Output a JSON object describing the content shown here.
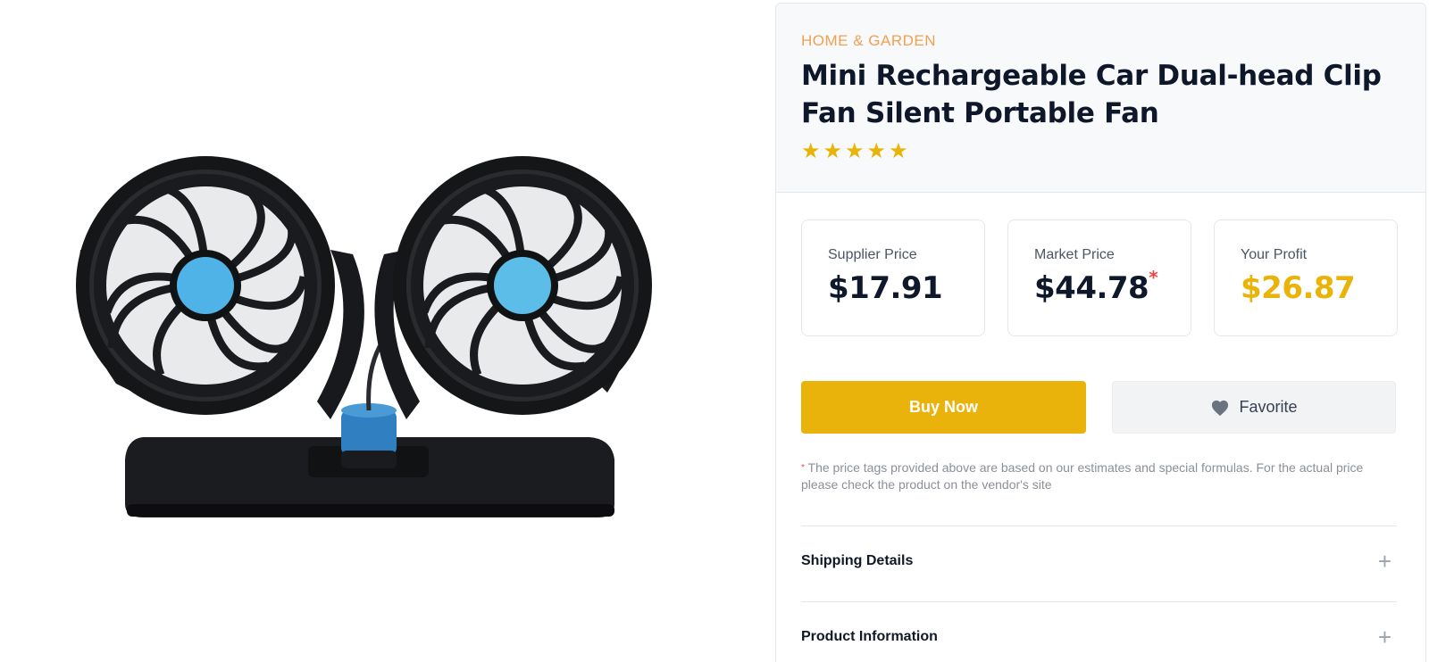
{
  "product": {
    "category": "HOME & GARDEN",
    "title": "Mini Rechargeable Car Dual-head Clip Fan Silent Portable Fan",
    "rating": 5,
    "stars": [
      "★",
      "★",
      "★",
      "★",
      "★"
    ]
  },
  "prices": {
    "supplier_label": "Supplier Price",
    "supplier_value": "$17.91",
    "market_label": "Market Price",
    "market_value": "$44.78",
    "market_asterisk": "*",
    "profit_label": "Your Profit",
    "profit_value": "$26.87"
  },
  "actions": {
    "buy_label": "Buy Now",
    "favorite_label": "Favorite"
  },
  "disclaimer": {
    "mark": "*",
    "text": "The price tags provided above are based on our estimates and special formulas. For the actual price please check the product on the vendor's site"
  },
  "accordion": [
    {
      "label": "Shipping Details",
      "icon": "+"
    },
    {
      "label": "Product Information",
      "icon": "+"
    }
  ],
  "colors": {
    "accent": "#e9b30b",
    "category": "#f0a050",
    "asterisk": "#ef4444",
    "fan_hub": "#4fb3e8"
  }
}
